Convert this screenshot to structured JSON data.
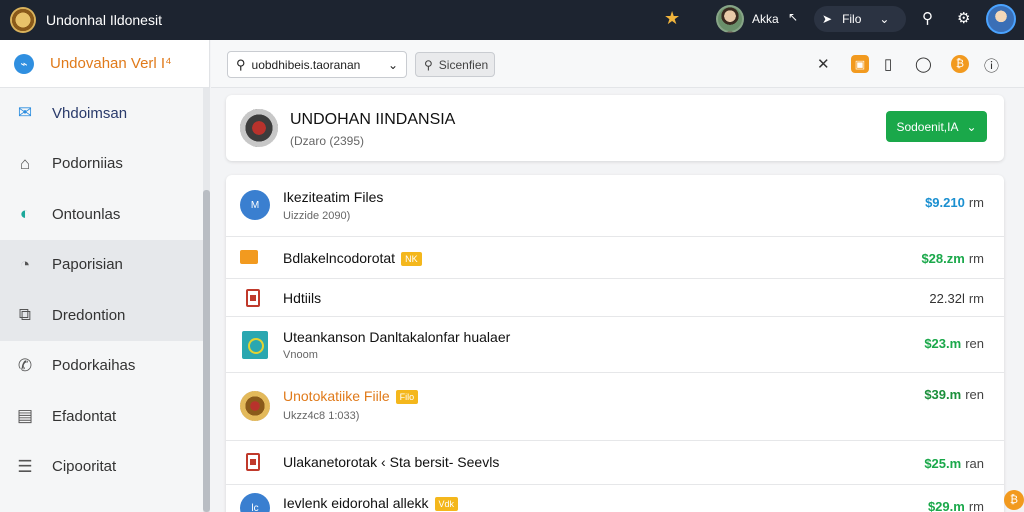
{
  "topbar": {
    "title": "Undonhal Ildonesit",
    "user_name": "Akka",
    "file_label": "Filo",
    "icons": [
      "seal-logo",
      "star-icon",
      "avatar",
      "cursor-icon",
      "send-icon",
      "chevron-down-icon",
      "search-icon",
      "gear-icon",
      "avatar"
    ]
  },
  "sidebar": {
    "title": "Undovahan Verl",
    "title_suffix": "I⁴",
    "items": [
      {
        "label": "Vhdoimsan",
        "icon": "mail-icon",
        "glyph": "✉"
      },
      {
        "label": "Podorniias",
        "icon": "home-icon",
        "glyph": "⌂"
      },
      {
        "label": "Ontounlas",
        "icon": "leaf-icon",
        "glyph": "◐"
      },
      {
        "label": "Paporisian",
        "icon": "tag-icon",
        "glyph": "◔"
      },
      {
        "label": "Dredontion",
        "icon": "copy-icon",
        "glyph": "⧉"
      },
      {
        "label": "Podorkaihas",
        "icon": "phone-icon",
        "glyph": "✆"
      },
      {
        "label": "Efadontat",
        "icon": "document-icon",
        "glyph": "▤"
      },
      {
        "label": "Cipooritat",
        "icon": "list-icon",
        "glyph": "☰"
      }
    ]
  },
  "toolbar": {
    "search_value": "uobdhibeis.taoranan",
    "search_button": "Sicenfien"
  },
  "header": {
    "title": "UNDOHAN IINDANSIA",
    "subtitle": "(Dzaro (2395)",
    "button_label": "Sodoenit,IA"
  },
  "rows": [
    {
      "title": "Ikeziteatim Files",
      "subtitle": "Uizzide 2090)",
      "value": "$9.210",
      "unit": "rm",
      "value_color": "#1a8fd0",
      "icon": "file-blue-icon",
      "icon_text": "M",
      "badge": ""
    },
    {
      "title": "Bdlakelncodorotat",
      "subtitle": "",
      "value": "$28.zm",
      "unit": "rm",
      "value_color": "#1aa84a",
      "icon": "folder-icon",
      "icon_text": "",
      "badge": "NK"
    },
    {
      "title": "Hdtiils",
      "subtitle": "",
      "value": "22.32l",
      "unit": "rm",
      "value_color": "#333333",
      "icon": "document-red-icon",
      "icon_text": "",
      "badge": ""
    },
    {
      "title": "Uteankanson Danltakalonfar hualaer",
      "subtitle": "Vnoom",
      "value": "$23.m",
      "unit": "ren",
      "value_color": "#1aa84a",
      "icon": "image-icon",
      "icon_text": "",
      "badge": ""
    },
    {
      "title": "Unotokatiike Fiile",
      "subtitle": "Ukzz4c8 1:033)",
      "value": "$39.m",
      "unit": "ren",
      "value_color": "#1a8f3a",
      "icon": "seal-icon",
      "icon_text": "",
      "badge": "Filo"
    },
    {
      "title": "Ulakanetorotak ‹ Sta bersit- Seevls",
      "subtitle": "",
      "value": "$25.m",
      "unit": "ran",
      "value_color": "#1aa84a",
      "icon": "document-red-icon",
      "icon_text": "",
      "badge": ""
    },
    {
      "title": "Ievlenk eidorohal allekk",
      "subtitle": "",
      "value": "$29.m",
      "unit": "rm",
      "value_color": "#1aa84a",
      "icon": "file-blue-icon",
      "icon_text": "lc",
      "badge": "Vdk"
    }
  ]
}
